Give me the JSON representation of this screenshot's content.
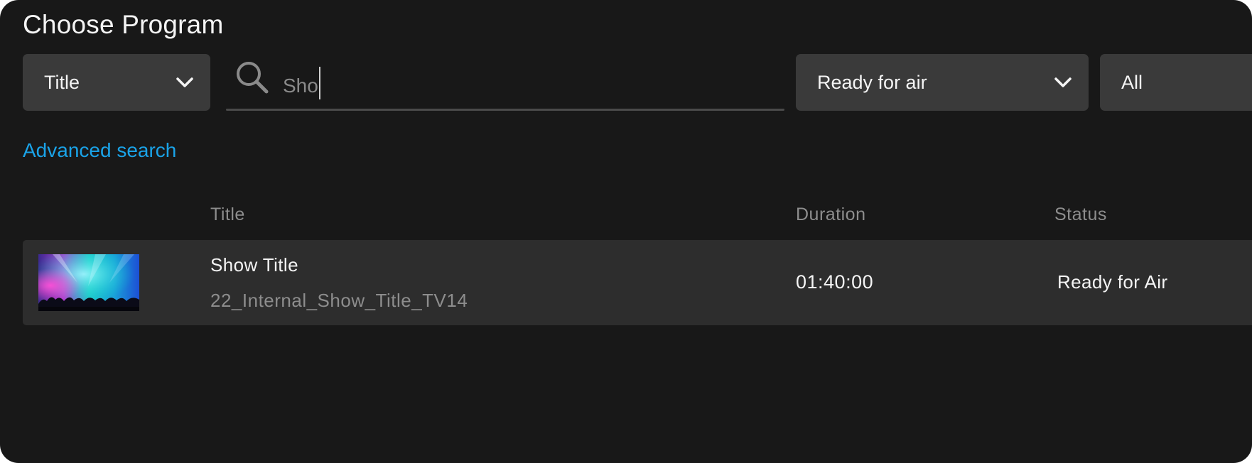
{
  "dialog": {
    "title": "Choose Program"
  },
  "filters": {
    "field_select": {
      "selected": "Title",
      "icon": "chevron-down-icon"
    },
    "search": {
      "value": "Sho",
      "icon": "search-icon"
    },
    "status_select": {
      "selected": "Ready for air",
      "icon": "chevron-down-icon"
    },
    "scope_select": {
      "selected": "All"
    }
  },
  "advanced_search": {
    "label": "Advanced search",
    "color": "#1aa3e8"
  },
  "table": {
    "columns": [
      "Title",
      "Duration",
      "Status"
    ],
    "rows": [
      {
        "thumbnail": "concert-stage-thumbnail",
        "title": "Show Title",
        "internal_name": "22_Internal_Show_Title_TV14",
        "duration": "01:40:00",
        "status": "Ready for Air"
      }
    ]
  },
  "colors": {
    "background": "#181818",
    "control": "#3a3a3a",
    "row": "#2d2d2d",
    "muted_text": "#8d8d8d"
  }
}
